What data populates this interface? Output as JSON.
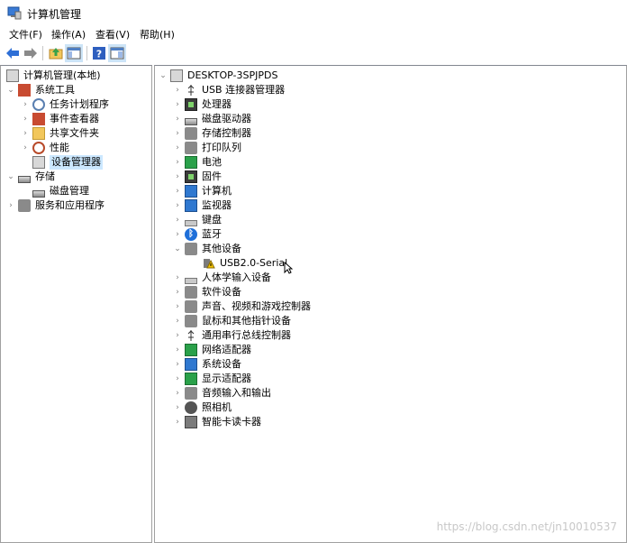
{
  "window": {
    "title": "计算机管理"
  },
  "menu": [
    "文件(F)",
    "操作(A)",
    "查看(V)",
    "帮助(H)"
  ],
  "toolbar": {
    "buttons": [
      "back-arrow-icon",
      "forward-arrow-icon",
      "up-folder-icon",
      "show-hide-tree-icon",
      "help-icon",
      "properties-icon"
    ]
  },
  "left_tree": {
    "root": "计算机管理(本地)",
    "system_tools": "系统工具",
    "task_scheduler": "任务计划程序",
    "event_viewer": "事件查看器",
    "shared_folders": "共享文件夹",
    "performance": "性能",
    "device_manager": "设备管理器",
    "storage": "存储",
    "disk_management": "磁盘管理",
    "services_apps": "服务和应用程序"
  },
  "device_tree": {
    "computer_name": "DESKTOP-3SPJPDS",
    "categories": [
      "USB 连接器管理器",
      "处理器",
      "磁盘驱动器",
      "存储控制器",
      "打印队列",
      "电池",
      "固件",
      "计算机",
      "监视器",
      "键盘",
      "蓝牙",
      "其他设备",
      "USB2.0-Serial",
      "人体学输入设备",
      "软件设备",
      "声音、视频和游戏控制器",
      "鼠标和其他指针设备",
      "通用串行总线控制器",
      "网络适配器",
      "系统设备",
      "显示适配器",
      "音频输入和输出",
      "照相机",
      "智能卡读卡器"
    ]
  },
  "watermark": "https://blog.csdn.net/jn10010537",
  "colors": {
    "selection": "#cce8ff",
    "accent": "#2b6bd1"
  }
}
